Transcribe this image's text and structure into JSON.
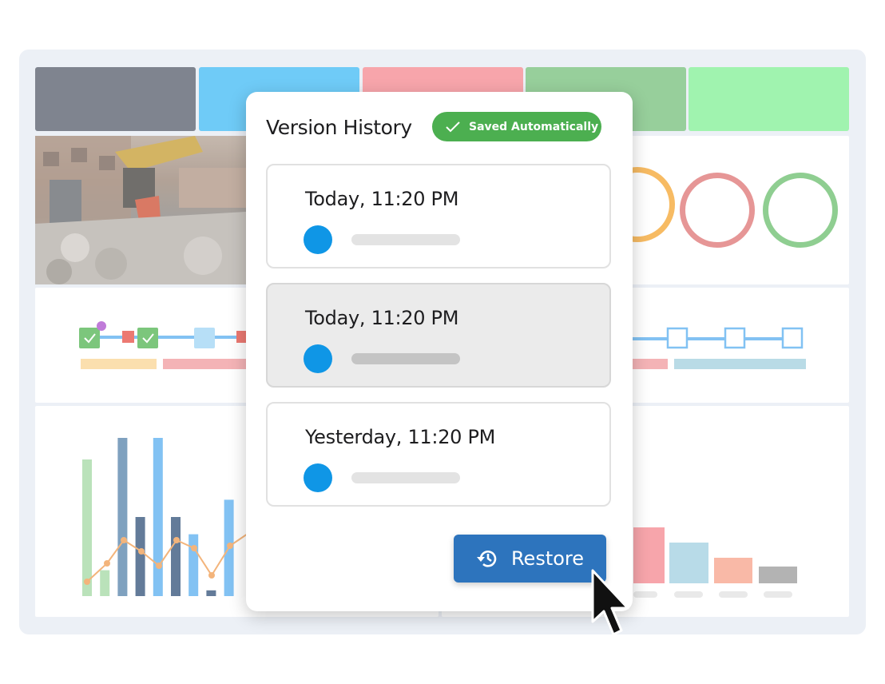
{
  "dashboard": {
    "header_tiles": [
      "#5f6674",
      "#4cbff5",
      "#f58f96",
      "#7dc382",
      "#89f09b"
    ],
    "rings": [
      "#f5aa3c",
      "#e07c7c",
      "#74c276"
    ],
    "chart_data": {
      "type": "bar",
      "categories": [],
      "series": [
        {
          "values": [
            9.5,
            1.8,
            11,
            5.5,
            11,
            5.5,
            4.3,
            0.4,
            6.7
          ]
        }
      ]
    }
  },
  "modal": {
    "title": "Version History",
    "badge": {
      "label": "Saved Automatically",
      "icon": "check-icon",
      "color": "#4caf50"
    },
    "versions": [
      {
        "label": "Today, 11:20 PM",
        "selected": false
      },
      {
        "label": "Today, 11:20 PM",
        "selected": true
      },
      {
        "label": "Yesterday, 11:20 PM",
        "selected": false
      }
    ],
    "restore": {
      "label": "Restore",
      "icon": "history-icon",
      "color": "#2d74bd"
    }
  },
  "cursor": {
    "icon": "mouse-pointer-icon"
  }
}
